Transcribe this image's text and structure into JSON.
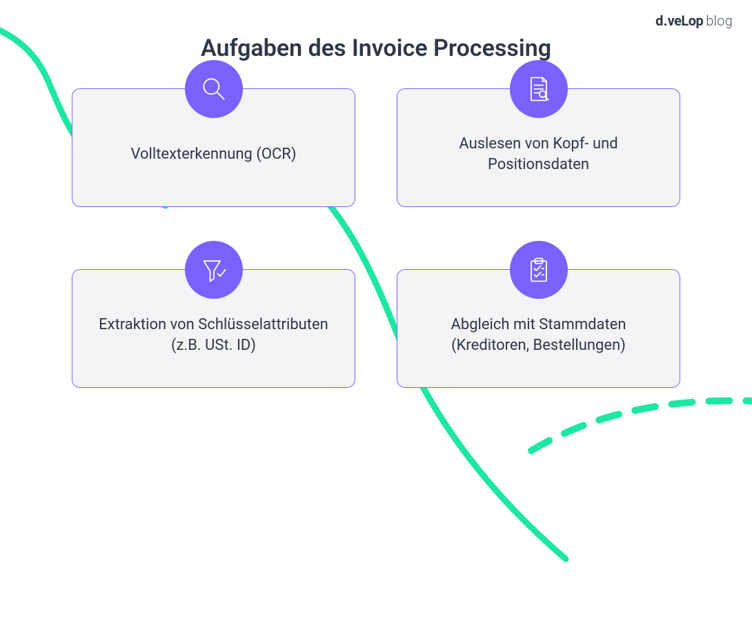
{
  "brand": {
    "d": "d.",
    "velop": "veLop",
    "blog": "blog"
  },
  "title": "Aufgaben des Invoice Processing",
  "cards": [
    {
      "label": "Volltexterkennung (OCR)",
      "icon": "magnifier-icon"
    },
    {
      "label": "Auslesen von Kopf- und\nPositionsdaten",
      "icon": "document-search-icon"
    },
    {
      "label": "Extraktion von Schlüsselattributen\n(z.B. USt. ID)",
      "icon": "funnel-check-icon"
    },
    {
      "label": "Abgleich mit Stammdaten\n(Kreditoren, Bestellungen)",
      "icon": "clipboard-check-icon"
    }
  ],
  "colors": {
    "accent": "#7b61ff",
    "curve": "#1ee6a4",
    "text": "#2d3748",
    "cardBg": "#f4f4f6"
  }
}
